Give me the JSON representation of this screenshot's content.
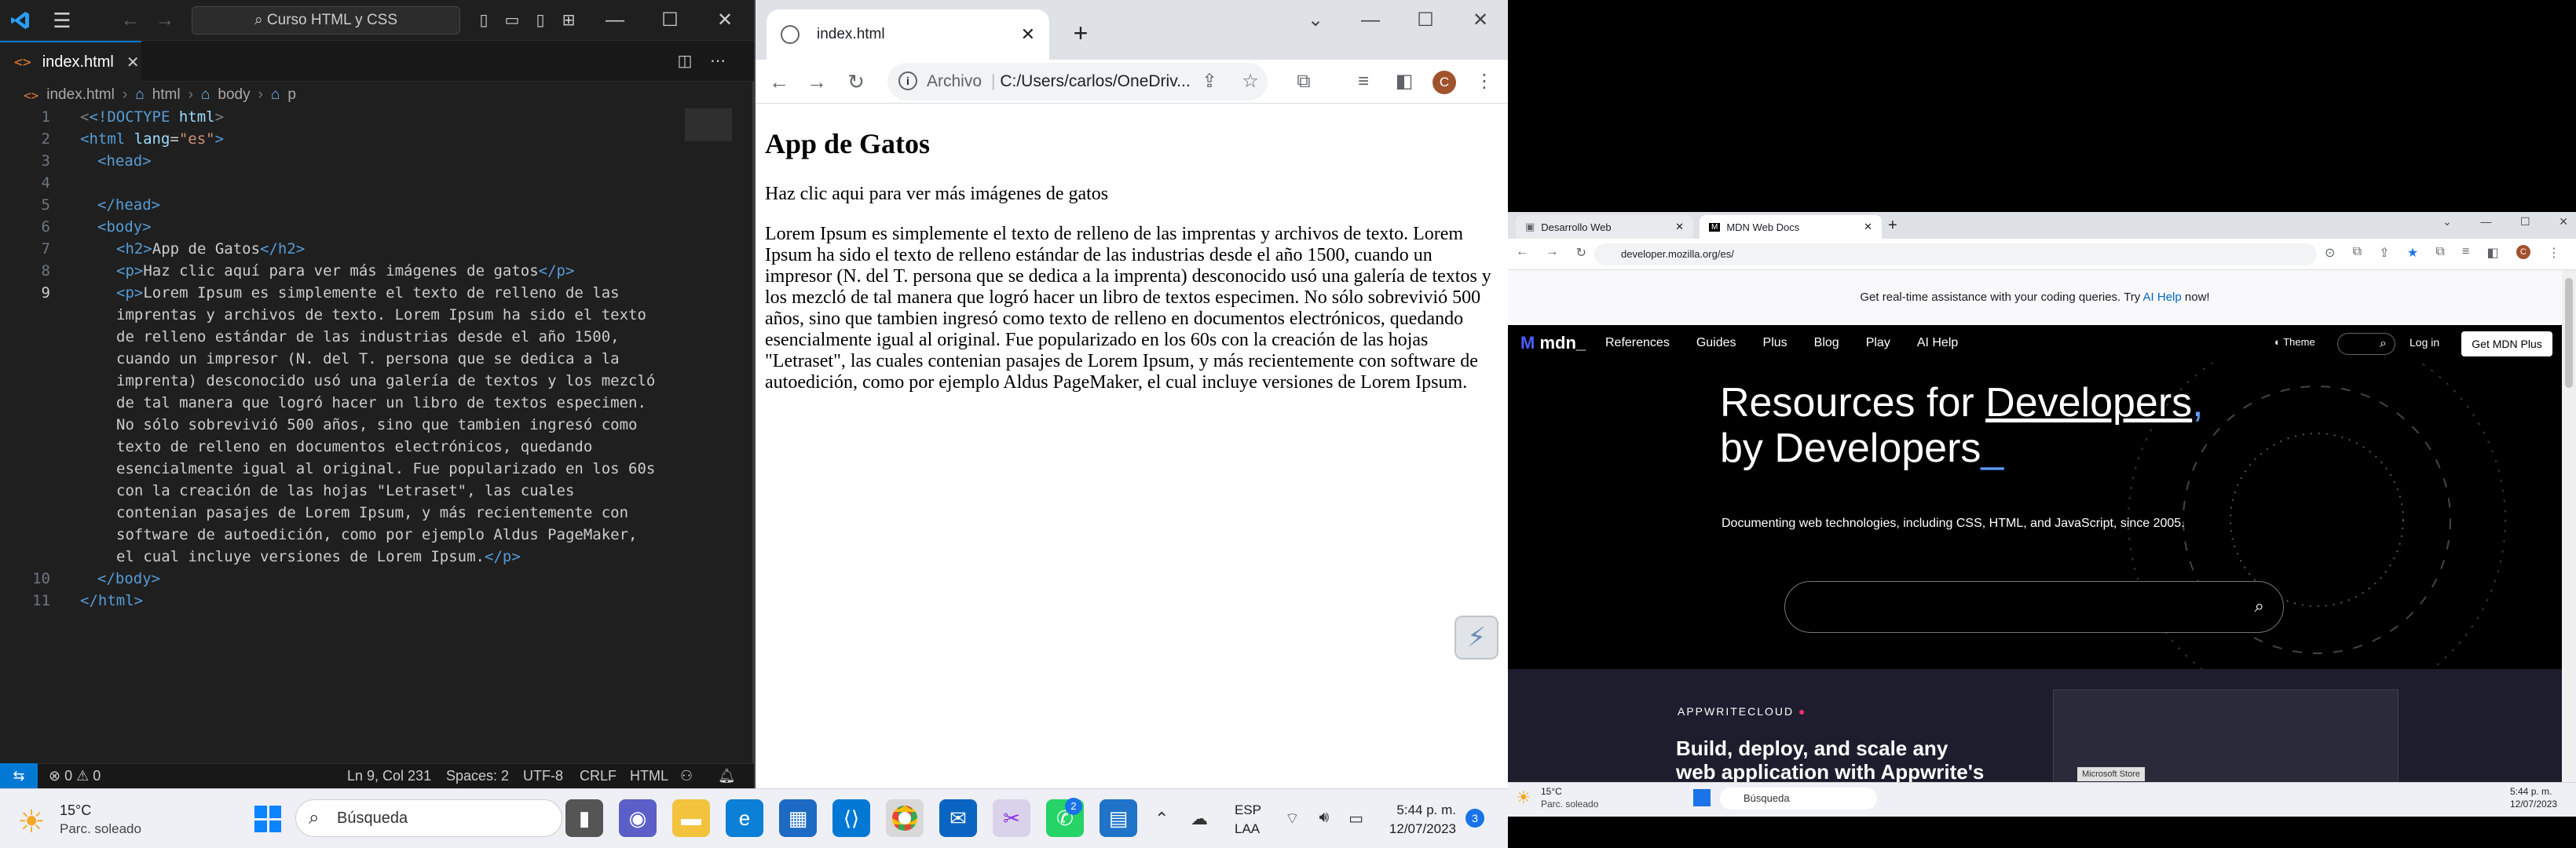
{
  "vscode": {
    "search_placeholder": "Curso HTML y CSS",
    "tab": {
      "label": "index.html",
      "close": "✕"
    },
    "breadcrumb": [
      "index.html",
      "html",
      "body",
      "p"
    ],
    "line_numbers": [
      "1",
      "2",
      "3",
      "4",
      "5",
      "6",
      "7",
      "8",
      "9",
      "10",
      "11"
    ],
    "code_lines": {
      "l1": [
        "<!DOCTYPE",
        " html",
        ">"
      ],
      "l2": [
        "<html ",
        "lang",
        "=",
        "\"es\"",
        ">"
      ],
      "l3": [
        "<head>"
      ],
      "l5": [
        "</head>"
      ],
      "l6": [
        "<body>"
      ],
      "l7": [
        "<h2>",
        "App de Gatos",
        "</h2>"
      ],
      "l8": [
        "<p>",
        "Haz clic aquí para ver más imágenes de gatos",
        "</p>"
      ],
      "l9": [
        "Lorem Ipsum es simplemente el texto de relleno de las",
        "imprentas y archivos de texto. Lorem Ipsum ha sido el texto",
        "de relleno estándar de las industrias desde el año 1500,",
        "cuando un impresor (N. del T. persona que se dedica a la",
        "imprenta) desconocido usó una galería de textos y los mezcló",
        "de tal manera que logró hacer un libro de textos especimen.",
        "No sólo sobrevivió 500 años, sino que tambien ingresó como",
        "texto de relleno en documentos electrónicos, quedando",
        "esencialmente igual al original. Fue popularizado en los 60s",
        "con la creación de las hojas \"Letraset\", las cuales",
        "contenian pasajes de Lorem Ipsum, y más recientemente con",
        "software de autoedición, como por ejemplo Aldus PageMaker,",
        "el cual incluye versiones de Lorem Ipsum."
      ],
      "l10": [
        "</body>"
      ],
      "l11": [
        "</html>"
      ]
    },
    "status": {
      "problems": "⊗ 0 ⚠ 0",
      "position": "Ln 9, Col 231",
      "spaces": "Spaces: 2",
      "encoding": "UTF-8",
      "eol": "CRLF",
      "language": "HTML"
    }
  },
  "chrome": {
    "tab_title": "index.html",
    "address_scheme": "Archivo",
    "address": "C:/Users/carlos/OneDriv...",
    "avatar": "C",
    "page": {
      "heading": "App de Gatos",
      "link_text": "Haz clic aqui para ver más imágenes de gatos",
      "paragraph": "Lorem Ipsum es simplemente el texto de relleno de las imprentas y archivos de texto. Lorem Ipsum ha sido el texto de relleno estándar de las industrias desde el año 1500, cuando un impresor (N. del T. persona que se dedica a la imprenta) desconocido usó una galería de textos y los mezcló de tal manera que logró hacer un libro de textos especimen. No sólo sobrevivió 500 años, sino que tambien ingresó como texto de relleno en documentos electrónicos, quedando esencialmente igual al original. Fue popularizado en los 60s con la creación de las hojas \"Letraset\", las cuales contenian pasajes de Lorem Ipsum, y más recientemente con software de autoedición, como por ejemplo Aldus PageMaker, el cual incluye versiones de Lorem Ipsum."
    }
  },
  "right_browser": {
    "tabs": [
      "Desarrollo Web",
      "MDN Web Docs"
    ],
    "address": "developer.mozilla.org/es/",
    "banner_text": "Get real-time assistance with your coding queries. Try ",
    "banner_link": "AI Help",
    "banner_end": " now!",
    "logo": "mdn_",
    "nav": [
      "References",
      "Guides",
      "Plus",
      "Blog",
      "Play",
      "AI Help"
    ],
    "nav_right": {
      "theme": "Theme",
      "login": "Log in",
      "cta": "Get MDN Plus"
    },
    "hero_line1_a": "Resources for ",
    "hero_line1_b": "Developers",
    "hero_line2": "by Developers",
    "hero_sub": "Documenting web technologies, including CSS, HTML, and JavaScript, since 2005.",
    "ad_brand": "APPWRITECLOUD",
    "ad_headline_1": "Build, deploy, and scale any",
    "ad_headline_2": "web application with Appwrite's",
    "ad_tooltip": "Microsoft Store",
    "taskbar": {
      "temp": "15°C",
      "weather": "Parc. soleado",
      "search": "Búsqueda",
      "time": "5:44 p. m.",
      "date": "12/07/2023"
    }
  },
  "taskbar": {
    "temp": "15°C",
    "weather": "Parc. soleado",
    "search": "Búsqueda",
    "lang1": "ESP",
    "lang2": "LAA",
    "time": "5:44 p. m.",
    "date": "12/07/2023",
    "notif": "3",
    "whatsapp_badge": "2"
  }
}
